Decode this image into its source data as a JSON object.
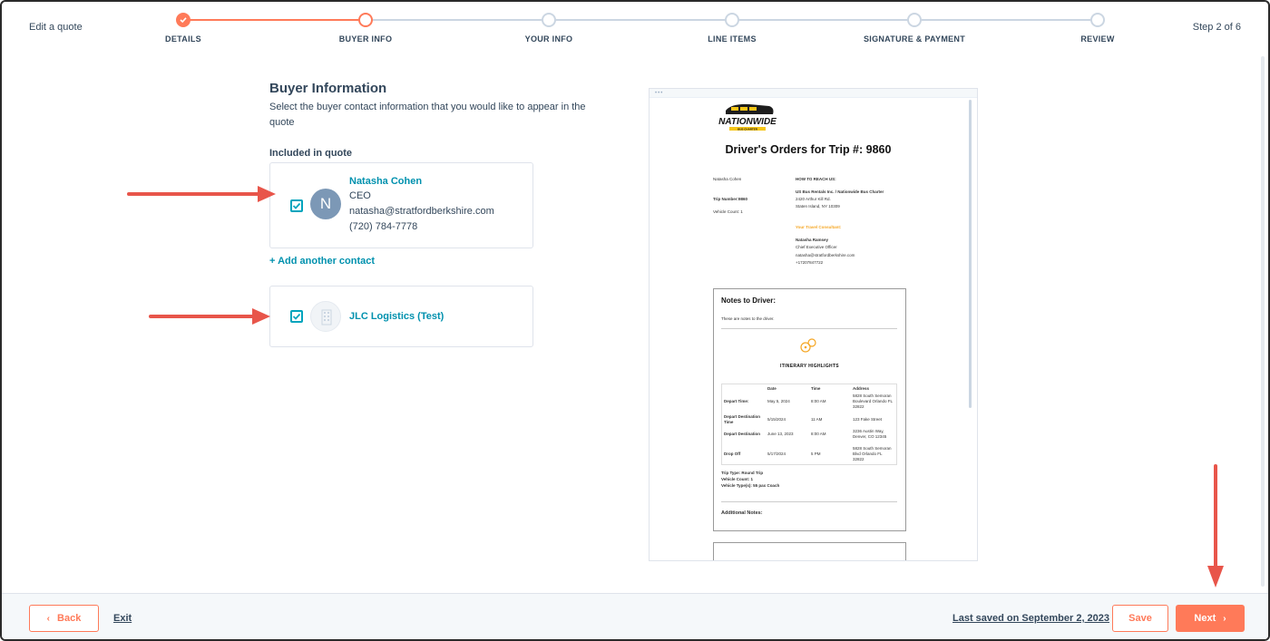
{
  "header": {
    "title": "Edit a quote",
    "step_counter": "Step 2 of 6",
    "steps": [
      {
        "label": "DETAILS",
        "state": "done"
      },
      {
        "label": "BUYER INFO",
        "state": "current"
      },
      {
        "label": "YOUR INFO",
        "state": "todo"
      },
      {
        "label": "LINE ITEMS",
        "state": "todo"
      },
      {
        "label": "SIGNATURE & PAYMENT",
        "state": "todo"
      },
      {
        "label": "REVIEW",
        "state": "todo"
      }
    ]
  },
  "buyer": {
    "title": "Buyer Information",
    "description": "Select the buyer contact information that you would like to appear in the quote",
    "included_label": "Included in quote",
    "contact": {
      "initial": "N",
      "name": "Natasha Cohen",
      "role": "CEO",
      "email": "natasha@stratfordberkshire.com",
      "phone": "(720) 784-7778",
      "checked": true
    },
    "add_contact": "+ Add another contact",
    "company": {
      "name": "JLC Logistics (Test)",
      "checked": true
    }
  },
  "preview": {
    "logo_text": "NATIONWIDE",
    "logo_sub": "BUS CHARTER",
    "title": "Driver's Orders for Trip #: 9860",
    "left": {
      "name": "Natasha Cohen",
      "trip_number": "Trip Number:9860",
      "vehicle_count": "Vehicle Count: 1"
    },
    "right": {
      "heading": "HOW TO REACH US:",
      "company": "US Bus Rentals Inc. / Nationwide Bus Charter",
      "addr1": "2420 Arthur Kill Rd.",
      "addr2": "Staten Island, NY 10309",
      "consultant_label": "Your Travel Consultant:",
      "consultant_name": "Natasha Ramsey",
      "consultant_role": "Chief Executive Officer",
      "consultant_email": "natasha@stratfordberkshire.com",
      "consultant_phone": "+17207847722"
    },
    "notes": {
      "title": "Notes to Driver:",
      "text": "These are notes to the driver.",
      "itinerary_title": "ITINERARY HIGHLIGHTS",
      "columns": [
        "Date",
        "Time",
        "Address"
      ],
      "rows": [
        {
          "label": "Depart Time:",
          "date": "May 5, 2024",
          "time": "8:00 AM",
          "address": "5828 South Semoran Boulevard Orlando FL 32822"
        },
        {
          "label": "Depart Destination Time",
          "date": "5/15/2024",
          "time": "11 AM",
          "address": "123 Fake Street"
        },
        {
          "label": "Depart Destination",
          "date": "June 13, 2023",
          "time": "8:00 AM",
          "address": "3236 Austin Way, Denver, CO 12345"
        },
        {
          "label": "Drop Off",
          "date": "5/17/2024",
          "time": "5 PM",
          "address": "5828 South Semoran Blvd Orlando FL 32822"
        }
      ],
      "trip_type": "Trip Type: Round Trip",
      "vehicle_count": "Vehicle Count: 1",
      "vehicle_types": "Vehicle Type(s): 55 pax Coach",
      "additional": "Additional Notes:"
    }
  },
  "footer": {
    "back": "Back",
    "exit": "Exit",
    "last_saved": "Last saved on September 2, 2023",
    "save": "Save",
    "next": "Next"
  },
  "colors": {
    "accent": "#ff7a59",
    "link": "#0091ae",
    "checkbox": "#00a4bd",
    "annotation_arrow": "#e8554a"
  }
}
